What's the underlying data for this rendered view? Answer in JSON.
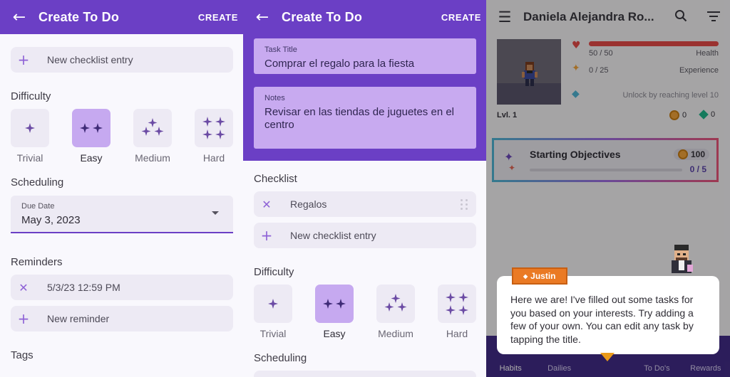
{
  "left": {
    "title": "Create To Do",
    "create": "CREATE",
    "new_checklist": "New checklist entry",
    "difficulty_label": "Difficulty",
    "difficulties": [
      "Trivial",
      "Easy",
      "Medium",
      "Hard"
    ],
    "selected_difficulty": "Easy",
    "scheduling_label": "Scheduling",
    "due_caption": "Due Date",
    "due_value": "May 3, 2023",
    "reminders_label": "Reminders",
    "reminder_value": "5/3/23 12:59 PM",
    "new_reminder": "New reminder",
    "tags_label": "Tags"
  },
  "middle": {
    "title": "Create To Do",
    "create": "CREATE",
    "task_title_caption": "Task Title",
    "task_title_value": "Comprar el regalo para la fiesta",
    "notes_caption": "Notes",
    "notes_value": "Revisar en las tiendas de juguetes en el centro",
    "checklist_label": "Checklist",
    "checklist_item": "Regalos",
    "new_checklist": "New checklist entry",
    "difficulty_label": "Difficulty",
    "difficulties": [
      "Trivial",
      "Easy",
      "Medium",
      "Hard"
    ],
    "selected_difficulty": "Easy",
    "scheduling_label": "Scheduling"
  },
  "right": {
    "user_name": "Daniela Alejandra Ro...",
    "level": "Lvl. 1",
    "health_value": "50 / 50",
    "health_label": "Health",
    "health_fraction": 1.0,
    "exp_value": "0 / 25",
    "exp_label": "Experience",
    "mana_text": "Unlock by reaching level 10",
    "gold": "0",
    "gems": "0",
    "objectives_title": "Starting Objectives",
    "objectives_reward": "100",
    "objectives_progress": "0 / 5",
    "speaker": "Justin",
    "message": "Here we are! I've filled out some tasks for you based on your interests. Try adding a few of your own. You can edit any task by tapping the title.",
    "nav": [
      "Habits",
      "Dailies",
      "To Do's",
      "Rewards"
    ],
    "colors": {
      "accent": "#6b3fc5",
      "health": "#e34a48",
      "nametag": "#ea7a24"
    }
  }
}
